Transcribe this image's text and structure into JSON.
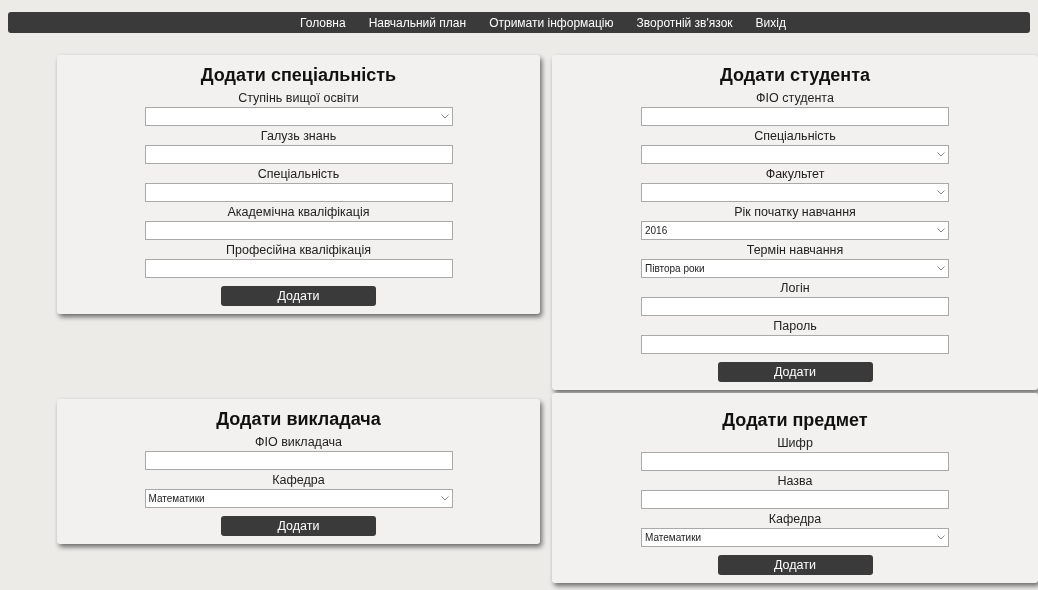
{
  "nav": {
    "items": [
      "Головна",
      "Навчальний план",
      "Отримати інформацію",
      "Зворотній зв'язок",
      "Вихід"
    ]
  },
  "left_column": [
    {
      "title": "Додати спеціальність",
      "button": "Додати",
      "fields": [
        {
          "label": "Ступінь вищої освіти",
          "kind": "select"
        },
        {
          "label": "Галузь знань",
          "kind": "text"
        },
        {
          "label": "Спеціальність",
          "kind": "text"
        },
        {
          "label": "Академічна кваліфікація",
          "kind": "text"
        },
        {
          "label": "Професійна кваліфікація",
          "kind": "text"
        }
      ]
    },
    {
      "title": "Додати викладача",
      "button": "Додати",
      "fields": [
        {
          "label": "ФІО викладача",
          "kind": "text"
        },
        {
          "label": "Кафедра",
          "kind": "select",
          "value": "Математики"
        }
      ]
    }
  ],
  "right_column": [
    {
      "title": "Додати студента",
      "button": "Додати",
      "fields": [
        {
          "label": "ФІО студента",
          "kind": "text"
        },
        {
          "label": "Спеціальність",
          "kind": "select"
        },
        {
          "label": "Факультет",
          "kind": "select"
        },
        {
          "label": "Рік початку навчання",
          "kind": "select",
          "value": "2016"
        },
        {
          "label": "Термін навчання",
          "kind": "select",
          "value": "Півтора роки"
        },
        {
          "label": "Логін",
          "kind": "text"
        },
        {
          "label": "Пароль",
          "kind": "text"
        }
      ]
    },
    {
      "title": "Додати предмет",
      "button": "Додати",
      "fields": [
        {
          "label": "Шифр",
          "kind": "text"
        },
        {
          "label": "Назва",
          "kind": "text"
        },
        {
          "label": "Кафедра",
          "kind": "select",
          "value": "Математики"
        }
      ]
    }
  ]
}
